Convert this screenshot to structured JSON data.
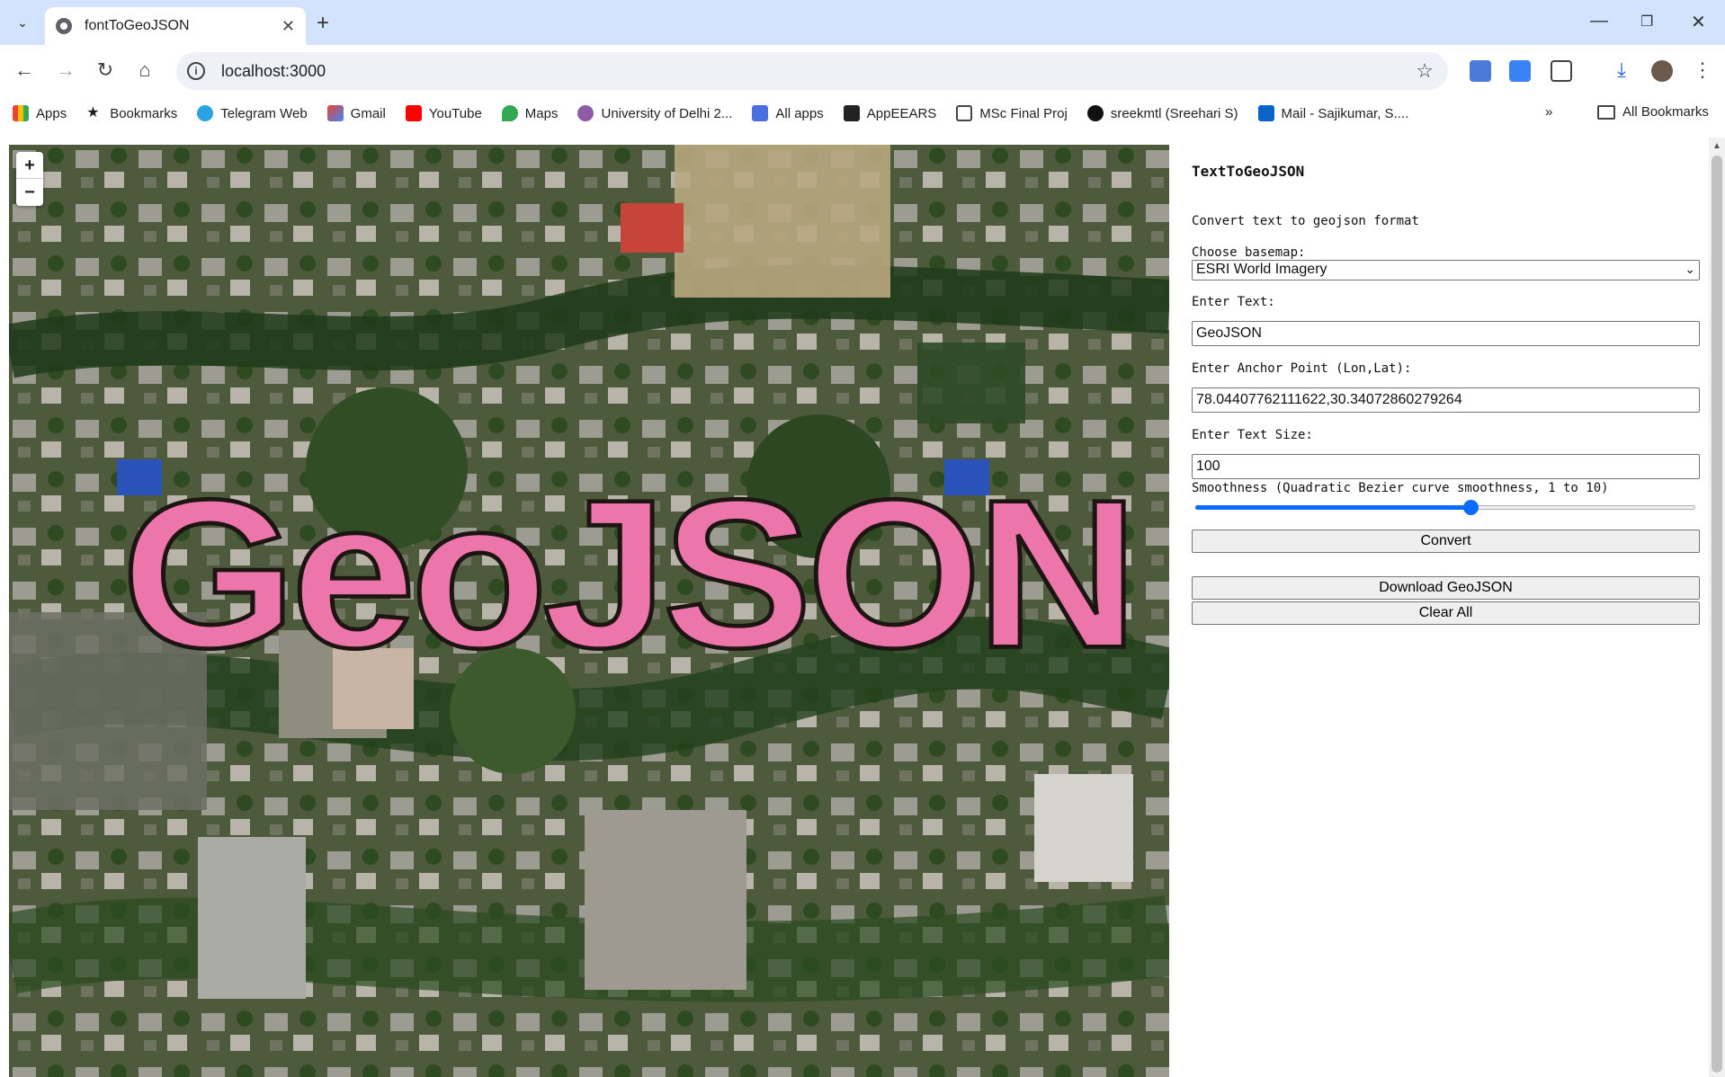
{
  "browser": {
    "tab_title": "fontToGeoJSON",
    "url": "localhost:3000",
    "bookmarks": [
      "Apps",
      "Bookmarks",
      "Telegram Web",
      "Gmail",
      "YouTube",
      "Maps",
      "University of Delhi 2...",
      "All apps",
      "AppEEARS",
      "MSc Final Proj",
      "sreekmtl (Sreehari S)",
      "Mail - Sajikumar, S...."
    ],
    "all_bookmarks": "All Bookmarks"
  },
  "map": {
    "zoom_in": "+",
    "zoom_out": "−",
    "rendered_text": "GeoJSON",
    "text_fill": "#ec75a9",
    "text_stroke": "#1c1512"
  },
  "panel": {
    "title": "TextToGeoJSON",
    "description": "Convert text to geojson format",
    "basemap_label": "Choose basemap:",
    "basemap_value": "ESRI World Imagery",
    "text_label": "Enter Text:",
    "text_value": "GeoJSON",
    "anchor_label": "Enter Anchor Point (Lon,Lat):",
    "anchor_value": "78.04407762111622,30.34072860279264",
    "size_label": "Enter Text Size:",
    "size_value": "100",
    "smoothness_label": "Smoothness (Quadratic Bezier curve smoothness, 1 to 10)",
    "smoothness_level": 0.55,
    "convert_button": "Convert",
    "download_button": "Download GeoJSON",
    "clear_button": "Clear All"
  }
}
